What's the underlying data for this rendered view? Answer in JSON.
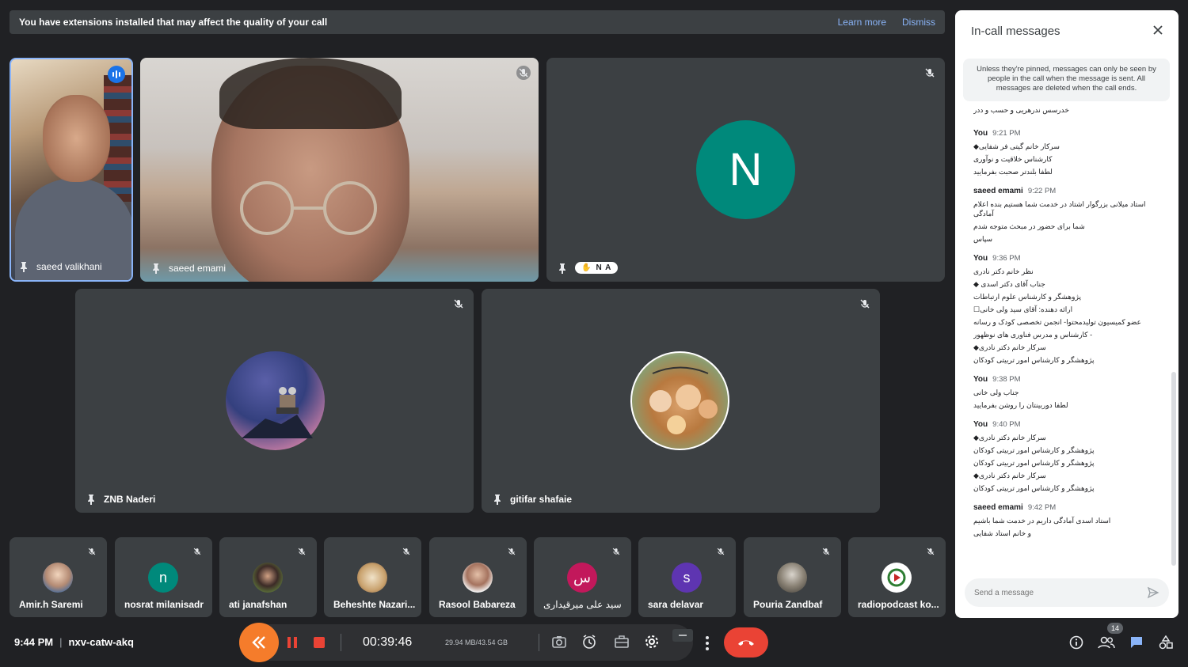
{
  "notice": {
    "message": "You have extensions installed that may affect the quality of your call",
    "learn_more": "Learn more",
    "dismiss": "Dismiss"
  },
  "tiles": {
    "t1": {
      "name": "saeed valikhani"
    },
    "t2": {
      "name": "saeed emami"
    },
    "t3": {
      "name": "N A",
      "initial": "N",
      "color": "#00897b"
    },
    "t4": {
      "name": "ZNB Naderi"
    },
    "t5": {
      "name": "gitifar shafaie"
    }
  },
  "strip": [
    {
      "name": "Amir.h Saremi"
    },
    {
      "name": "nosrat milanisadr",
      "initial": "n",
      "color": "#00897b"
    },
    {
      "name": "ati janafshan"
    },
    {
      "name": "Beheshte Nazari..."
    },
    {
      "name": "Rasool Babareza"
    },
    {
      "name": "سید علی میرقیداری",
      "initial": "س",
      "color": "#c2185b"
    },
    {
      "name": "sara delavar",
      "initial": "s",
      "color": "#5e35b1"
    },
    {
      "name": "Pouria Zandbaf"
    },
    {
      "name": "radiopodcast ko..."
    }
  ],
  "panel": {
    "title": "In-call messages",
    "info": "Unless they're pinned, messages can only be seen by people in the call when the message is sent. All messages are deleted when the call ends.",
    "top_line": "خدرسس ندرهریی و حسب و ددر",
    "messages": [
      {
        "sender": "You",
        "time": "9:21 PM",
        "lines": [
          "سرکار خانم گیتی فر شفایی◆",
          "کارشناس خلاقیت و نوآوری",
          "لطفا بلندتر صحبت بفرمایید"
        ]
      },
      {
        "sender": "saeed emami",
        "time": "9:22 PM",
        "lines": [
          "استاد میلانی بزرگوار اشتاد در خدمت شما هستیم بنده اعلام آمادگی",
          "شما برای حضور در مبحث متوجه شدم",
          "سپاس"
        ]
      },
      {
        "sender": "You",
        "time": "9:36 PM",
        "lines": [
          "نظر خانم دکتر نادری",
          "جناب آقای دکتر اسدی ◆",
          "پژوهشگر و کارشناس علوم ارتباطات",
          "ارائه دهنده: آقای سید ولی خانی☐",
          "عضو کمیسیون تولیدمحتوا- انجمن تخصصی کودک و رسانه",
          "- کارشناس و مدرس فناوری های نوظهور",
          "سرکار خانم دکتر نادری◆",
          "پژوهشگر و کارشناس امور تربیتی کودکان"
        ]
      },
      {
        "sender": "You",
        "time": "9:38 PM",
        "lines": [
          "جناب ولی خانی",
          "لطفا دوربینتان را روشن بفرمایید"
        ]
      },
      {
        "sender": "You",
        "time": "9:40 PM",
        "lines": [
          "سرکار خانم دکتر نادری◆",
          "پژوهشگر و کارشناس امور تربیتی کودکان",
          "پژوهشگر و کارشناس امور تربیتی کودکان",
          "سرکار خانم دکتر نادری◆",
          "پژوهشگر و کارشناس امور تربیتی کودکان"
        ]
      },
      {
        "sender": "saeed emami",
        "time": "9:42 PM",
        "lines": [
          "استاد اسدی آمادگی داریم در خدمت شما باشیم",
          "و خانم استاد شفایی"
        ]
      }
    ],
    "send_placeholder": "Send a message"
  },
  "bottom": {
    "time": "9:44 PM",
    "meeting_code": "nxv-catw-akq",
    "timer": "00:39:46",
    "storage": "29.94 MB/43.54 GB",
    "people_count": "14"
  },
  "colors": {
    "accent": "#8ab4f8",
    "end_call": "#ea4335",
    "record_orange": "#f57c2b",
    "record_red": "#ea4335"
  }
}
